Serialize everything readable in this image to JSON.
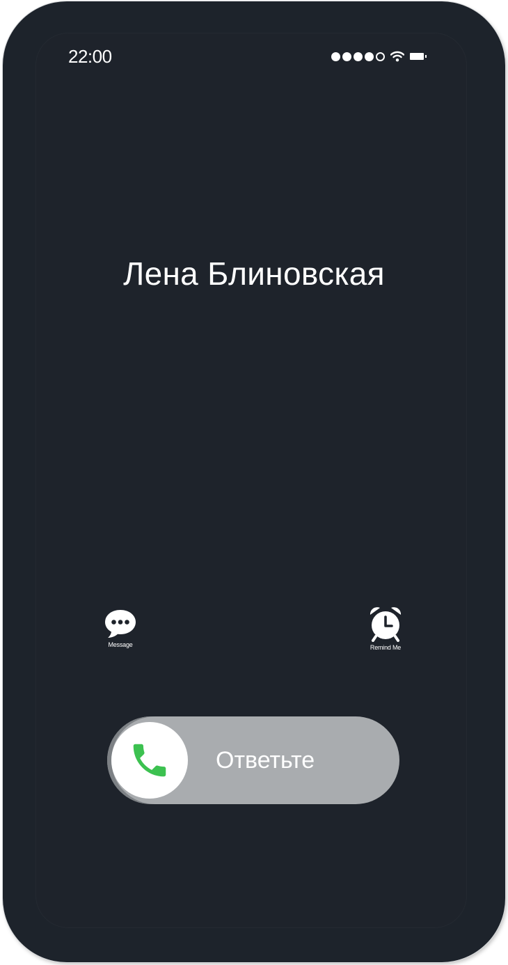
{
  "status_bar": {
    "time": "22:00",
    "signal_dots_filled": 4,
    "signal_dots_total": 5,
    "wifi_icon": "wifi-icon",
    "battery_icon": "battery-icon"
  },
  "call": {
    "caller_name": "Лена Блиновская"
  },
  "actions": {
    "message": {
      "label": "Message",
      "icon": "chat-bubble-icon"
    },
    "remind": {
      "label": "Remind Me",
      "icon": "alarm-clock-icon"
    }
  },
  "answer_slider": {
    "label": "Ответьте",
    "icon": "phone-icon",
    "icon_color": "#3cc150"
  },
  "colors": {
    "background": "#1e232b",
    "text": "#ffffff",
    "slider_track": "#a9acaf",
    "answer_green": "#3cc150"
  }
}
